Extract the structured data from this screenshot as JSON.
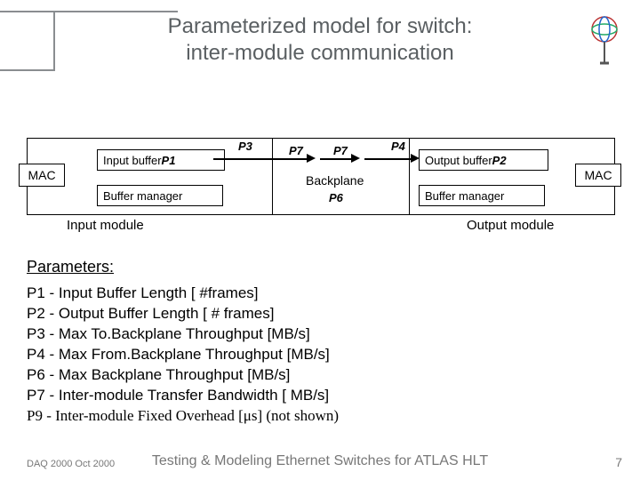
{
  "title_line1": "Parameterized model for switch:",
  "title_line2": "inter-module communication",
  "diagram": {
    "mac": "MAC",
    "input_buffer": "Input buffer ",
    "input_buffer_param": "P1",
    "output_buffer": "Output buffer ",
    "output_buffer_param": "P2",
    "buffer_manager": "Buffer manager",
    "backplane": "Backplane",
    "input_module": "Input module",
    "output_module": "Output module",
    "P3": "P3",
    "P4": "P4",
    "P6": "P6",
    "P7": "P7"
  },
  "params_heading": "Parameters:",
  "params": [
    "P1 - Input Buffer Length [ #frames]",
    "P2 - Output Buffer Length [ # frames]",
    "P3 - Max To.Backplane Throughput [MB/s]",
    "P4 - Max From.Backplane Throughput [MB/s]",
    "P6 - Max Backplane Throughput [MB/s]",
    "P7 - Inter-module Transfer Bandwidth [ MB/s]",
    "P9 - Inter-module Fixed Overhead [μs] (not shown)"
  ],
  "footer": {
    "left": "DAQ 2000 Oct 2000",
    "center": "Testing & Modeling Ethernet Switches for ATLAS HLT",
    "right": "7"
  },
  "chart_data": {
    "type": "diagram",
    "nodes": [
      {
        "id": "in_module",
        "label": "Input module",
        "contains": [
          "mac_left",
          "input_buffer_P1",
          "buffer_manager_in"
        ]
      },
      {
        "id": "center",
        "label": "Backplane / P6",
        "contains": [
          "backplane",
          "P6"
        ]
      },
      {
        "id": "out_module",
        "label": "Output module",
        "contains": [
          "output_buffer_P2",
          "buffer_manager_out",
          "mac_right"
        ]
      }
    ],
    "edges": [
      {
        "from": "input_buffer_P1",
        "to": "center",
        "label": "P3 / P7"
      },
      {
        "from": "center",
        "to": "output_buffer_P2",
        "label": "P4 / P7"
      }
    ],
    "parameters": {
      "P1": "Input Buffer Length [#frames]",
      "P2": "Output Buffer Length [# frames]",
      "P3": "Max To.Backplane Throughput [MB/s]",
      "P4": "Max From.Backplane Throughput [MB/s]",
      "P6": "Max Backplane Throughput [MB/s]",
      "P7": "Inter-module Transfer Bandwidth [MB/s]",
      "P9": "Inter-module Fixed Overhead [μs] (not shown)"
    }
  }
}
